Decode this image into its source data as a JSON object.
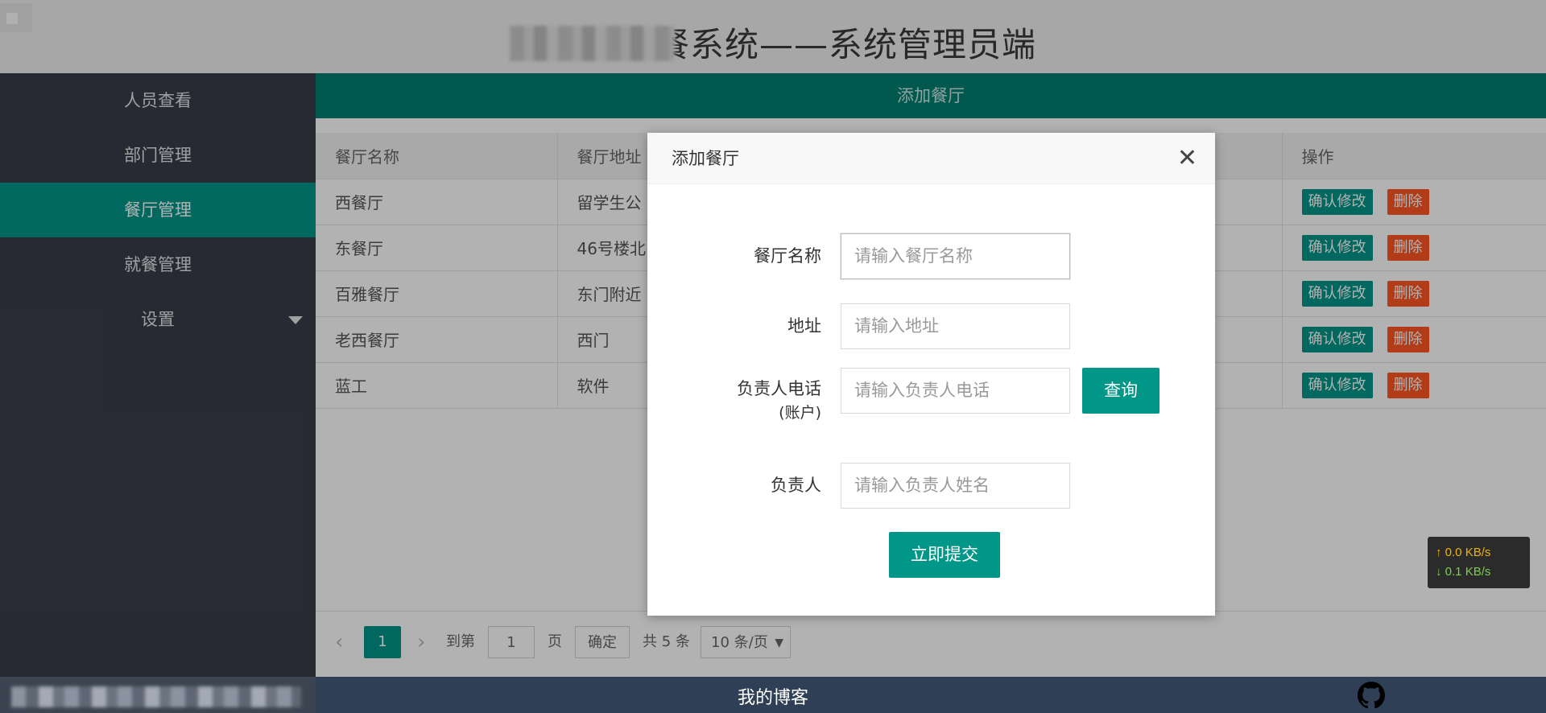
{
  "header": {
    "title_visible": "餐系统——系统管理员端"
  },
  "sidebar": {
    "items": [
      {
        "label": "人员查看",
        "active": false
      },
      {
        "label": "部门管理",
        "active": false
      },
      {
        "label": "餐厅管理",
        "active": true
      },
      {
        "label": "就餐管理",
        "active": false
      },
      {
        "label": "设置",
        "active": false
      }
    ]
  },
  "main": {
    "page_title": "添加餐厅",
    "table": {
      "columns": [
        "餐厅名称",
        "餐厅地址",
        "操作"
      ],
      "rows": [
        {
          "name": "西餐厅",
          "address": "留学生公"
        },
        {
          "name": "东餐厅",
          "address": "46号楼北"
        },
        {
          "name": "百雅餐厅",
          "address": "东门附近"
        },
        {
          "name": "老西餐厅",
          "address": "西门"
        },
        {
          "name": "蓝工",
          "address": "软件"
        }
      ],
      "edit_label": "确认修改",
      "delete_label": "删除"
    },
    "pager": {
      "current": "1",
      "goto_label": "到第",
      "goto_value": "1",
      "page_unit": "页",
      "confirm_label": "确定",
      "total": "共 5 条",
      "page_size": "10 条/页"
    }
  },
  "modal": {
    "title": "添加餐厅",
    "fields": [
      {
        "label": "餐厅名称",
        "placeholder": "请输入餐厅名称"
      },
      {
        "label": "地址",
        "placeholder": "请输入地址"
      },
      {
        "label": "负责人电话",
        "label2": "(账户)",
        "placeholder": "请输入负责人电话"
      },
      {
        "label": "负责人",
        "placeholder": "请输入负责人姓名"
      }
    ],
    "query_label": "查询",
    "submit_label": "立即提交"
  },
  "speed": {
    "up": "0.0 KB/s",
    "down": "0.1 KB/s"
  },
  "footer": {
    "blog": "我的博客"
  },
  "colors": {
    "primary": "#009688",
    "danger": "#ff5722",
    "sidebar": "#393d49",
    "header_bar": "#007e70"
  }
}
